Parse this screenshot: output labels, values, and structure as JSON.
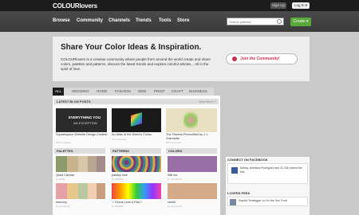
{
  "topbar": {
    "logo": "COLOURlovers",
    "signup": "Sign Up",
    "login": "Log In ▾"
  },
  "nav": {
    "items": [
      "Browse",
      "Community",
      "Channels",
      "Trends",
      "Tools",
      "Store"
    ],
    "search_placeholder": "Search palettes",
    "create": "Create ▾"
  },
  "hero": {
    "title": "Share Your Color Ideas & Inspiration.",
    "text": "COLOURlovers is a creative community where people from around the world create and share colors, palettes and patterns, discuss the latest trends and explore colorful articles... All in the spirit of love.",
    "join": "Join the Community!"
  },
  "tabs": [
    "ALL",
    "WEDDING",
    "HOME",
    "FASHION",
    "WEB",
    "PRINT",
    "CRAFT",
    "BUSINESS"
  ],
  "blog": {
    "header": "LATEST BLOG POSTS",
    "view_more": "View More »",
    "hero_text_1": "EVERYTHING YOU",
    "hero_text_2": "AN EXCEPTION",
    "posts": [
      {
        "title": "Squarespace Website Design Contest",
        "comments": "28 Comments"
      },
      {
        "title": "An Atlas of the World's Colors",
        "comments": "70 Comments"
      },
      {
        "title": "The Flowers Personified by J.J. Grandville",
        "comments": "28 Comments"
      }
    ]
  },
  "palettes": {
    "header": "PALETTES",
    "items": [
      {
        "name": "Quiet Canvas",
        "by": "by thistle"
      },
      {
        "name": "memory",
        "by": "by numberoff"
      }
    ]
  },
  "patterns": {
    "header": "PATTERNS",
    "items": [
      {
        "name": "paisley love",
        "by": "by WOMart"
      },
      {
        "name": "☺Circus Love A Plat☺",
        "by": "by WOMart"
      }
    ]
  },
  "colors": {
    "header": "COLORS",
    "items": [
      {
        "name": "Still me",
        "by": "by numberoff"
      },
      {
        "name": "cheliti",
        "by": "by numberoff"
      }
    ]
  },
  "sidebar": {
    "fb_header": "CONNECT ON FACEBOOK",
    "fb_text": "Kiessy, Abellana Rodriguez and 32,336 others like this.",
    "peek_header": "LOVERS PEEK",
    "peek_text": "Sepeta Tenttegger on On the Sun Front"
  }
}
